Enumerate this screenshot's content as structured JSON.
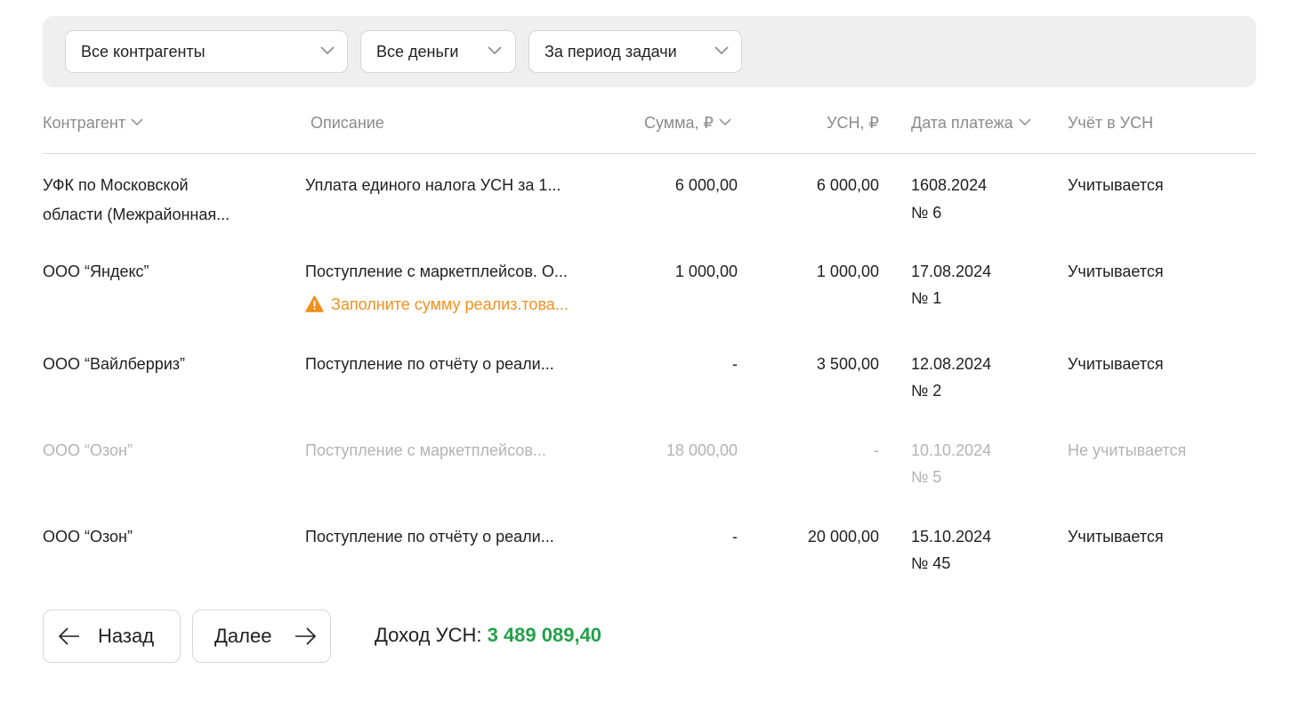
{
  "filters": [
    {
      "selected": "Все контрагенты"
    },
    {
      "selected": "Все деньги"
    },
    {
      "selected": "За период задачи"
    }
  ],
  "table": {
    "columns": {
      "counterparty": "Контрагент",
      "description": "Описание",
      "amount": "Сумма, ₽",
      "usn": "УСН, ₽",
      "pay_date": "Дата платежа",
      "usn_account": "Учёт в УСН"
    },
    "rows": [
      {
        "counterparty_1": "УФК по Московской",
        "counterparty_2": "области (Межрайонная...",
        "description": "Уплата единого налога УСН за 1...",
        "amount": "6 000,00",
        "usn": "6 000,00",
        "date": "1608.2024",
        "number": "№ 6",
        "status": "Учитывается"
      },
      {
        "counterparty_1": "ООО “Яндекс”",
        "description": "Поступление с маркетплейсов. О...",
        "warning": "Заполните сумму реализ.това...",
        "amount": "1 000,00",
        "usn": "1 000,00",
        "date": "17.08.2024",
        "number": "№ 1",
        "status": "Учитывается"
      },
      {
        "counterparty_1": "ООО “Вайлберриз”",
        "description": "Поступление по отчёту о реали...",
        "amount": "-",
        "usn": "3 500,00",
        "date": "12.08.2024",
        "number": "№ 2",
        "status": "Учитывается"
      },
      {
        "counterparty_1": "ООО “Озон”",
        "description": "Поступление с маркетплейсов...",
        "amount": "18 000,00",
        "usn": "-",
        "date": "10.10.2024",
        "number": "№ 5",
        "status": "Не учитывается"
      },
      {
        "counterparty_1": "ООО “Озон”",
        "description": "Поступление по отчёту о реали...",
        "amount": "-",
        "usn": "20 000,00",
        "date": "15.10.2024",
        "number": "№ 45",
        "status": "Учитывается"
      }
    ]
  },
  "pager": {
    "back": "Назад",
    "next": "Далее"
  },
  "income": {
    "label": "Доход УСН:",
    "value": "3 489 089,40"
  },
  "colors": {
    "accent_green": "#23a14a",
    "warning_orange": "#f0911c",
    "muted_text": "#b3b3b3"
  }
}
